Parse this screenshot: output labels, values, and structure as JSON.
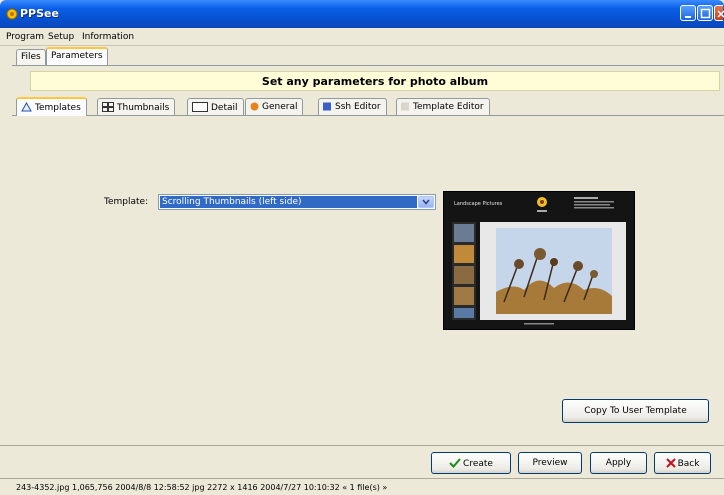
{
  "window": {
    "title": "PPSee"
  },
  "menu": [
    "Program",
    "Setup",
    "Information"
  ],
  "outer_tabs": [
    {
      "label": "Files",
      "active": false
    },
    {
      "label": "Parameters",
      "active": true
    }
  ],
  "banner": "Set any parameters for photo album",
  "inner_tabs": [
    {
      "label": "Templates",
      "icon": "triangle-icon",
      "active": true
    },
    {
      "label": "Thumbnails",
      "icon": "grid-icon",
      "active": false
    },
    {
      "label": "Detail",
      "icon": "blank-page-icon",
      "active": false
    },
    {
      "label": "General",
      "icon": "orange-dot-icon",
      "active": false
    },
    {
      "label": "Ssh Editor",
      "icon": "blue-square-icon",
      "active": false
    },
    {
      "label": "Template Editor",
      "icon": "gray-square-icon",
      "active": false
    }
  ],
  "template": {
    "label": "Template:",
    "value": "Scrolling Thumbnails (left side)"
  },
  "preview": {
    "title": "Landscape Pictures"
  },
  "copy_button": "Copy To User Template",
  "buttons": {
    "create": "Create",
    "preview": "Preview",
    "apply": "Apply",
    "back": "Back"
  },
  "status": "243-4352.jpg     1,065,756  2004/8/8 12:58:52  jpg  2272 x 1416  2004/7/27 10:10:32  « 1 file(s) »",
  "colors": {
    "titlebar": "#0a5fe6",
    "selection": "#316ac5",
    "banner": "#fffdd8",
    "active_tab_accent": "#ffc83c"
  }
}
